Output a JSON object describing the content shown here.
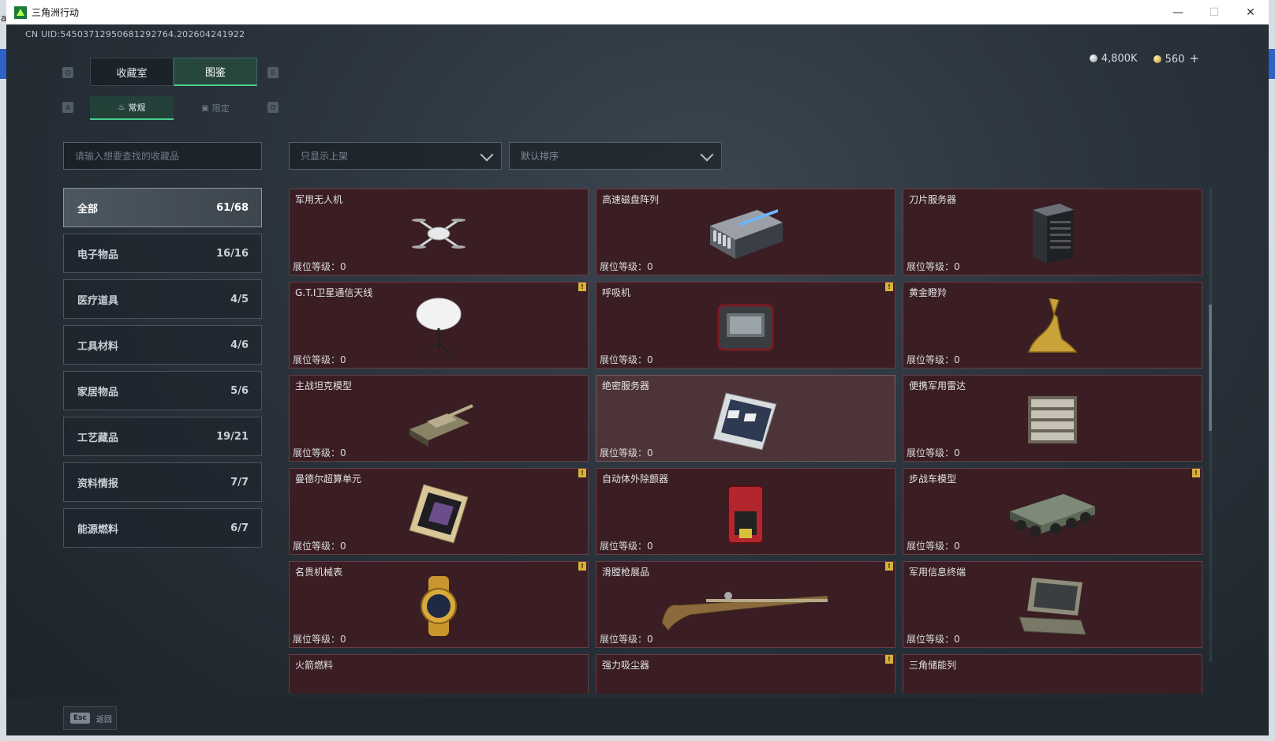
{
  "window": {
    "title": "三角洲行动",
    "controls": [
      "—",
      "☐",
      "✕"
    ],
    "edge_letter": "a"
  },
  "uid": "CN UID:54503712950681292764.202604241922",
  "currency": {
    "silver": "4,800K",
    "gold": "560",
    "plus": "+"
  },
  "key_hints": {
    "prev_tab": "Q",
    "next_tab": "E",
    "prev_sub": "A",
    "next_sub": "D"
  },
  "tabs": [
    {
      "label": "收藏室"
    },
    {
      "label": "图鉴"
    }
  ],
  "subtabs": [
    {
      "label": "常规",
      "icon": "flame-icon"
    },
    {
      "label": "限定",
      "icon": "box-icon"
    }
  ],
  "search": {
    "placeholder": "请输入想要查找的收藏品"
  },
  "filters": {
    "shelf": "只显示上架",
    "sort": "默认排序"
  },
  "categories": [
    {
      "name": "全部",
      "count": "61/68"
    },
    {
      "name": "电子物品",
      "count": "16/16"
    },
    {
      "name": "医疗道具",
      "count": "4/5"
    },
    {
      "name": "工具材料",
      "count": "4/6"
    },
    {
      "name": "家居物品",
      "count": "5/6"
    },
    {
      "name": "工艺藏品",
      "count": "19/21"
    },
    {
      "name": "资料情报",
      "count": "7/7"
    },
    {
      "name": "能源燃料",
      "count": "6/7"
    }
  ],
  "level_label": "展位等级：",
  "items": [
    {
      "name": "军用无人机",
      "level": "0",
      "badge": false,
      "icon": "drone-icon"
    },
    {
      "name": "高速磁盘阵列",
      "level": "0",
      "badge": false,
      "icon": "disk-array-icon"
    },
    {
      "name": "刀片服务器",
      "level": "0",
      "badge": false,
      "icon": "blade-server-icon"
    },
    {
      "name": "G.T.I卫星通信天线",
      "level": "0",
      "badge": true,
      "icon": "satellite-dish-icon"
    },
    {
      "name": "呼吸机",
      "level": "0",
      "badge": true,
      "icon": "ventilator-icon"
    },
    {
      "name": "黄金瞪羚",
      "level": "0",
      "badge": false,
      "icon": "gazelle-icon"
    },
    {
      "name": "主战坦克模型",
      "level": "0",
      "badge": false,
      "icon": "tank-icon"
    },
    {
      "name": "绝密服务器",
      "level": "0",
      "badge": false,
      "icon": "server-icon"
    },
    {
      "name": "便携军用雷达",
      "level": "0",
      "badge": false,
      "icon": "radar-icon"
    },
    {
      "name": "曼德尔超算单元",
      "level": "0",
      "badge": true,
      "icon": "chip-icon"
    },
    {
      "name": "自动体外除颤器",
      "level": "0",
      "badge": false,
      "icon": "defibrillator-icon"
    },
    {
      "name": "步战车模型",
      "level": "0",
      "badge": true,
      "icon": "ifv-icon"
    },
    {
      "name": "名贵机械表",
      "level": "0",
      "badge": true,
      "icon": "watch-icon"
    },
    {
      "name": "滑膛枪展品",
      "level": "0",
      "badge": true,
      "icon": "musket-icon"
    },
    {
      "name": "军用信息终端",
      "level": "0",
      "badge": false,
      "icon": "terminal-icon"
    },
    {
      "name": "火箭燃料",
      "level": "",
      "badge": false,
      "icon": "fuel-icon"
    },
    {
      "name": "强力吸尘器",
      "level": "",
      "badge": true,
      "icon": "vacuum-icon"
    },
    {
      "name": "三角储能列",
      "level": "",
      "badge": false,
      "icon": "battery-icon"
    }
  ],
  "back": {
    "key": "Esc",
    "label": "返回"
  }
}
